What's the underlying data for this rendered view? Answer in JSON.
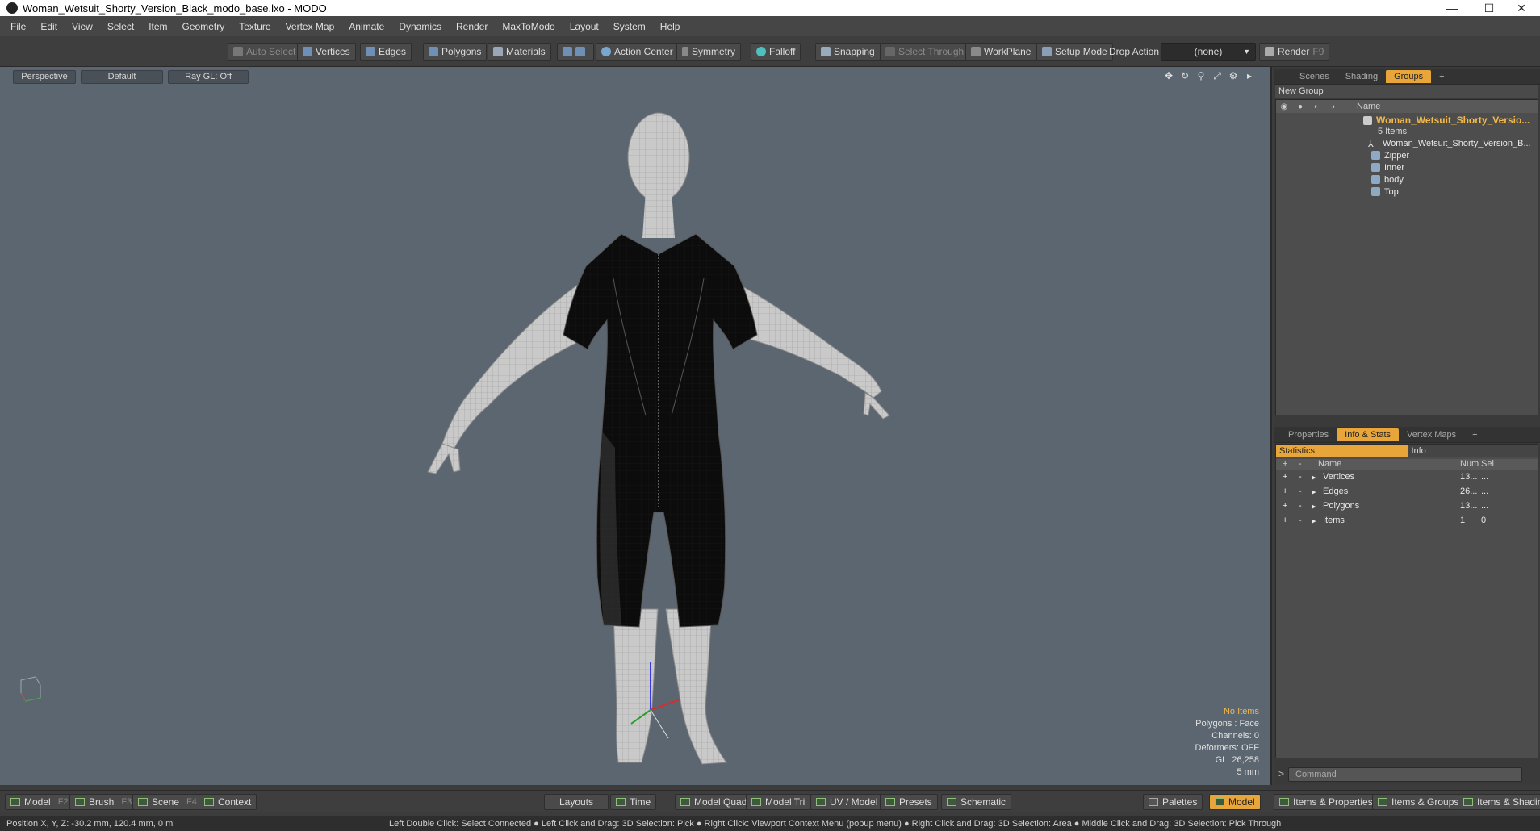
{
  "window": {
    "title": "Woman_Wetsuit_Shorty_Version_Black_modo_base.lxo - MODO",
    "minimize": "—",
    "maximize": "☐",
    "close": "✕"
  },
  "menu": [
    "File",
    "Edit",
    "View",
    "Select",
    "Item",
    "Geometry",
    "Texture",
    "Vertex Map",
    "Animate",
    "Dynamics",
    "Render",
    "MaxToModo",
    "Layout",
    "System",
    "Help"
  ],
  "toolbar": {
    "auto_select": "Auto Select",
    "vertices": "Vertices",
    "edges": "Edges",
    "polygons": "Polygons",
    "materials": "Materials",
    "action_center": "Action Center",
    "symmetry": "Symmetry",
    "falloff": "Falloff",
    "snapping": "Snapping",
    "select_through": "Select Through",
    "workplane": "WorkPlane",
    "setup_mode": "Setup Mode",
    "drop_action": "Drop Action",
    "drop_value": "(none)",
    "render": "Render",
    "render_key": "F9"
  },
  "viewport": {
    "view": "Perspective",
    "shading": "Default",
    "raygl": "Ray GL: Off",
    "info": {
      "items": "No Items",
      "polygons": "Polygons : Face",
      "channels": "Channels: 0",
      "deformers": "Deformers: OFF",
      "gl": "GL: 26,258",
      "scale": "5 mm"
    }
  },
  "scene_panel": {
    "tabs": [
      "Scenes",
      "Shading",
      "Groups"
    ],
    "new_group": "New Group",
    "col_name": "Name",
    "group_name": "Woman_Wetsuit_Shorty_Versio...",
    "group_count": "5 Items",
    "children": [
      "Woman_Wetsuit_Shorty_Version_B...",
      "Zipper",
      "Inner",
      "body",
      "Top"
    ]
  },
  "stats_panel": {
    "tabs": [
      "Properties",
      "Info & Stats",
      "Vertex Maps"
    ],
    "sub_tabs": [
      "Statistics",
      "Info"
    ],
    "headers": {
      "name": "Name",
      "num": "Num",
      "sel": "Sel"
    },
    "rows": [
      {
        "plus": "+",
        "minus": "-",
        "name": "Vertices",
        "num": "13...",
        "sel": "..."
      },
      {
        "plus": "+",
        "minus": "-",
        "name": "Edges",
        "num": "26...",
        "sel": "..."
      },
      {
        "plus": "+",
        "minus": "-",
        "name": "Polygons",
        "num": "13...",
        "sel": "..."
      },
      {
        "plus": "+",
        "minus": "-",
        "name": "Items",
        "num": "1",
        "sel": "0"
      }
    ]
  },
  "command": {
    "placeholder": "Command"
  },
  "bottom": {
    "model": "Model",
    "model_key": "F2",
    "brush": "Brush",
    "brush_key": "F3",
    "scene": "Scene",
    "scene_key": "F4",
    "context": "Context",
    "layouts": "Layouts",
    "time": "Time",
    "model_quad": "Model Quad",
    "model_tri": "Model Tri",
    "uv_model": "UV / Model",
    "presets": "Presets",
    "schematic": "Schematic",
    "palettes": "Palettes",
    "model_active": "Model",
    "items_properties": "Items & Properties",
    "items_groups": "Items & Groups",
    "items_shading": "Items & Shading"
  },
  "status": {
    "position": "Position X, Y, Z:   -30.2 mm, 120.4 mm, 0 m",
    "hint": "Left Double Click: Select Connected ● Left Click and Drag: 3D Selection: Pick ● Right Click: Viewport Context Menu (popup menu) ● Right Click and Drag: 3D Selection: Area ● Middle Click and Drag: 3D Selection: Pick Through"
  },
  "colors": {
    "accent": "#e7a53a",
    "viewport_bg": "#5c6670",
    "highlight_text": "#f2b84a"
  }
}
